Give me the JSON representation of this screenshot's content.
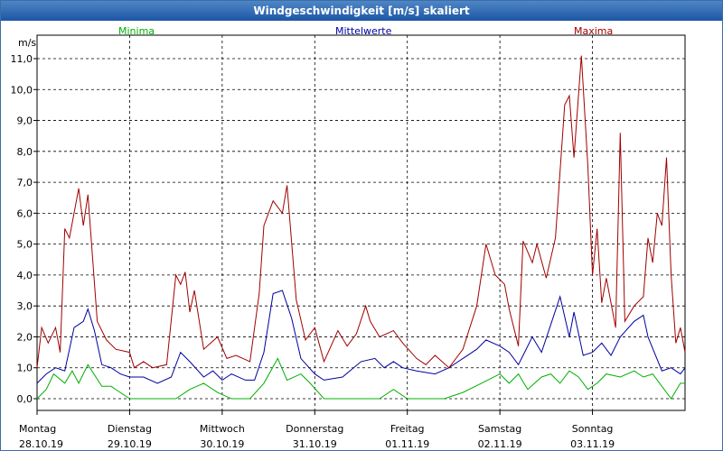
{
  "window": {
    "title": "Windgeschwindigkeit [m/s] skaliert"
  },
  "chart_data": {
    "type": "line",
    "title": "Windgeschwindigkeit [m/s] skaliert",
    "ylabel": "m/s",
    "ylim": [
      0,
      11.4
    ],
    "yticks": [
      "0,0",
      "1,0",
      "2,0",
      "3,0",
      "4,0",
      "5,0",
      "6,0",
      "7,0",
      "8,0",
      "9,0",
      "10,0",
      "11,0"
    ],
    "xlim": [
      0,
      7
    ],
    "xlabels": [
      {
        "day": "Montag",
        "date": "28.10.19"
      },
      {
        "day": "Dienstag",
        "date": "29.10.19"
      },
      {
        "day": "Mittwoch",
        "date": "30.10.19"
      },
      {
        "day": "Donnerstag",
        "date": "31.10.19"
      },
      {
        "day": "Freitag",
        "date": "01.11.19"
      },
      {
        "day": "Samstag",
        "date": "02.11.19"
      },
      {
        "day": "Sonntag",
        "date": "03.11.19"
      }
    ],
    "grid": true,
    "series": [
      {
        "name": "Minima",
        "color": "#00b000",
        "points": [
          [
            0,
            0
          ],
          [
            0.1,
            0.3
          ],
          [
            0.18,
            0.8
          ],
          [
            0.3,
            0.5
          ],
          [
            0.38,
            0.9
          ],
          [
            0.45,
            0.5
          ],
          [
            0.55,
            1.1
          ],
          [
            0.7,
            0.4
          ],
          [
            0.8,
            0.4
          ],
          [
            1.0,
            0
          ],
          [
            1.2,
            0
          ],
          [
            1.4,
            0
          ],
          [
            1.5,
            0
          ],
          [
            1.65,
            0.3
          ],
          [
            1.8,
            0.5
          ],
          [
            1.95,
            0.2
          ],
          [
            2.1,
            0
          ],
          [
            2.25,
            0
          ],
          [
            2.3,
            0
          ],
          [
            2.45,
            0.5
          ],
          [
            2.6,
            1.3
          ],
          [
            2.7,
            0.6
          ],
          [
            2.85,
            0.8
          ],
          [
            2.95,
            0.5
          ],
          [
            3.1,
            0
          ],
          [
            3.3,
            0
          ],
          [
            3.5,
            0
          ],
          [
            3.7,
            0
          ],
          [
            3.85,
            0.3
          ],
          [
            4.0,
            0
          ],
          [
            4.2,
            0
          ],
          [
            4.4,
            0
          ],
          [
            4.6,
            0.2
          ],
          [
            4.8,
            0.5
          ],
          [
            5.0,
            0.8
          ],
          [
            5.1,
            0.5
          ],
          [
            5.2,
            0.8
          ],
          [
            5.3,
            0.3
          ],
          [
            5.45,
            0.7
          ],
          [
            5.55,
            0.8
          ],
          [
            5.65,
            0.5
          ],
          [
            5.75,
            0.9
          ],
          [
            5.85,
            0.7
          ],
          [
            5.95,
            0.3
          ],
          [
            6.05,
            0.5
          ],
          [
            6.15,
            0.8
          ],
          [
            6.3,
            0.7
          ],
          [
            6.45,
            0.9
          ],
          [
            6.55,
            0.7
          ],
          [
            6.65,
            0.8
          ],
          [
            6.75,
            0.4
          ],
          [
            6.85,
            0
          ],
          [
            6.95,
            0.5
          ],
          [
            7.0,
            0.5
          ]
        ]
      },
      {
        "name": "Mittelwerte",
        "color": "#0000a0",
        "points": [
          [
            0,
            0.5
          ],
          [
            0.1,
            0.8
          ],
          [
            0.2,
            1.0
          ],
          [
            0.3,
            0.9
          ],
          [
            0.4,
            2.3
          ],
          [
            0.5,
            2.5
          ],
          [
            0.55,
            2.9
          ],
          [
            0.62,
            2.2
          ],
          [
            0.7,
            1.1
          ],
          [
            0.8,
            1.0
          ],
          [
            0.9,
            0.8
          ],
          [
            1.0,
            0.7
          ],
          [
            1.15,
            0.7
          ],
          [
            1.3,
            0.5
          ],
          [
            1.45,
            0.7
          ],
          [
            1.55,
            1.5
          ],
          [
            1.65,
            1.2
          ],
          [
            1.8,
            0.7
          ],
          [
            1.9,
            0.9
          ],
          [
            2.0,
            0.6
          ],
          [
            2.1,
            0.8
          ],
          [
            2.25,
            0.6
          ],
          [
            2.35,
            0.6
          ],
          [
            2.45,
            1.5
          ],
          [
            2.55,
            3.4
          ],
          [
            2.65,
            3.5
          ],
          [
            2.75,
            2.6
          ],
          [
            2.85,
            1.3
          ],
          [
            3.0,
            0.8
          ],
          [
            3.1,
            0.6
          ],
          [
            3.3,
            0.7
          ],
          [
            3.5,
            1.2
          ],
          [
            3.65,
            1.3
          ],
          [
            3.75,
            1.0
          ],
          [
            3.85,
            1.2
          ],
          [
            3.95,
            1.0
          ],
          [
            4.1,
            0.9
          ],
          [
            4.3,
            0.8
          ],
          [
            4.45,
            1.0
          ],
          [
            4.6,
            1.3
          ],
          [
            4.75,
            1.6
          ],
          [
            4.85,
            1.9
          ],
          [
            5.0,
            1.7
          ],
          [
            5.1,
            1.5
          ],
          [
            5.2,
            1.1
          ],
          [
            5.25,
            1.4
          ],
          [
            5.35,
            2.0
          ],
          [
            5.45,
            1.5
          ],
          [
            5.55,
            2.4
          ],
          [
            5.65,
            3.3
          ],
          [
            5.75,
            2.0
          ],
          [
            5.8,
            2.8
          ],
          [
            5.9,
            1.4
          ],
          [
            6.0,
            1.5
          ],
          [
            6.1,
            1.8
          ],
          [
            6.2,
            1.4
          ],
          [
            6.3,
            2.0
          ],
          [
            6.45,
            2.5
          ],
          [
            6.55,
            2.7
          ],
          [
            6.6,
            2.0
          ],
          [
            6.75,
            0.9
          ],
          [
            6.85,
            1.0
          ],
          [
            6.95,
            0.8
          ],
          [
            7.0,
            1.0
          ]
        ]
      },
      {
        "name": "Maxima",
        "color": "#a00000",
        "points": [
          [
            0,
            1.0
          ],
          [
            0.05,
            2.3
          ],
          [
            0.12,
            1.8
          ],
          [
            0.2,
            2.3
          ],
          [
            0.25,
            1.5
          ],
          [
            0.3,
            5.5
          ],
          [
            0.35,
            5.2
          ],
          [
            0.45,
            6.8
          ],
          [
            0.5,
            5.6
          ],
          [
            0.55,
            6.6
          ],
          [
            0.65,
            2.5
          ],
          [
            0.75,
            1.9
          ],
          [
            0.85,
            1.6
          ],
          [
            1.0,
            1.5
          ],
          [
            1.05,
            1.0
          ],
          [
            1.15,
            1.2
          ],
          [
            1.25,
            1.0
          ],
          [
            1.4,
            1.1
          ],
          [
            1.5,
            4.0
          ],
          [
            1.55,
            3.7
          ],
          [
            1.6,
            4.1
          ],
          [
            1.65,
            2.8
          ],
          [
            1.7,
            3.5
          ],
          [
            1.8,
            1.6
          ],
          [
            1.95,
            2.0
          ],
          [
            2.05,
            1.3
          ],
          [
            2.15,
            1.4
          ],
          [
            2.3,
            1.2
          ],
          [
            2.4,
            3.4
          ],
          [
            2.45,
            5.6
          ],
          [
            2.55,
            6.4
          ],
          [
            2.65,
            6.0
          ],
          [
            2.7,
            6.9
          ],
          [
            2.8,
            3.2
          ],
          [
            2.9,
            1.9
          ],
          [
            3.0,
            2.3
          ],
          [
            3.1,
            1.2
          ],
          [
            3.25,
            2.2
          ],
          [
            3.35,
            1.7
          ],
          [
            3.45,
            2.1
          ],
          [
            3.55,
            3.0
          ],
          [
            3.6,
            2.5
          ],
          [
            3.7,
            2.0
          ],
          [
            3.85,
            2.2
          ],
          [
            3.95,
            1.8
          ],
          [
            4.1,
            1.3
          ],
          [
            4.2,
            1.1
          ],
          [
            4.3,
            1.4
          ],
          [
            4.45,
            1.0
          ],
          [
            4.6,
            1.6
          ],
          [
            4.75,
            3.0
          ],
          [
            4.85,
            5.0
          ],
          [
            4.95,
            4.0
          ],
          [
            5.05,
            3.7
          ],
          [
            5.1,
            2.9
          ],
          [
            5.2,
            1.7
          ],
          [
            5.25,
            5.1
          ],
          [
            5.35,
            4.4
          ],
          [
            5.4,
            5.0
          ],
          [
            5.5,
            3.9
          ],
          [
            5.6,
            5.2
          ],
          [
            5.7,
            9.5
          ],
          [
            5.75,
            9.8
          ],
          [
            5.8,
            7.8
          ],
          [
            5.88,
            11.1
          ],
          [
            5.95,
            7.5
          ],
          [
            6.0,
            4.0
          ],
          [
            6.05,
            5.5
          ],
          [
            6.1,
            3.1
          ],
          [
            6.15,
            3.9
          ],
          [
            6.25,
            2.3
          ],
          [
            6.3,
            8.6
          ],
          [
            6.35,
            2.5
          ],
          [
            6.45,
            3.0
          ],
          [
            6.55,
            3.3
          ],
          [
            6.6,
            5.2
          ],
          [
            6.65,
            4.4
          ],
          [
            6.7,
            6.0
          ],
          [
            6.75,
            5.6
          ],
          [
            6.8,
            7.8
          ],
          [
            6.85,
            4.0
          ],
          [
            6.9,
            1.8
          ],
          [
            6.95,
            2.3
          ],
          [
            7.0,
            1.5
          ]
        ]
      }
    ]
  }
}
